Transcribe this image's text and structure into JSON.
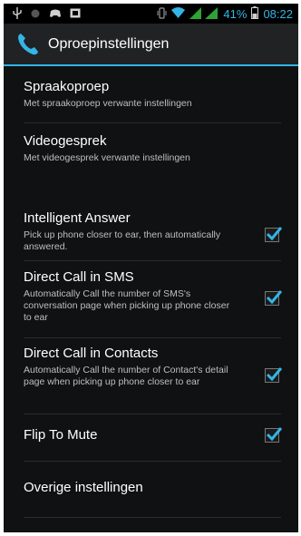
{
  "status_bar": {
    "battery_percent": "41%",
    "time": "08:22",
    "icons": [
      "usb-icon",
      "notification-icon",
      "gamepad-icon",
      "image-icon",
      "vibrate-icon",
      "wifi-icon",
      "signal-icon",
      "battery-icon"
    ]
  },
  "action_bar": {
    "title": "Oproepinstellingen",
    "icon": "phone-icon"
  },
  "settings": [
    {
      "title": "Spraakoproep",
      "subtitle": "Met spraakoproep verwante instellingen"
    },
    {
      "title": "Videogesprek",
      "subtitle": "Met videogesprek verwante instellingen"
    },
    {
      "title": "Intelligent Answer",
      "subtitle": "Pick up phone closer to ear, then automatically answered.",
      "checked": true
    },
    {
      "title": "Direct Call in SMS",
      "subtitle": "Automatically Call the number of SMS's conversation page when picking up phone closer to ear",
      "checked": true
    },
    {
      "title": "Direct Call in Contacts",
      "subtitle": "Automatically Call the number of Contact's detail page when picking up phone closer to ear",
      "checked": true
    },
    {
      "title": "Flip To Mute",
      "checked": true
    },
    {
      "title": "Overige instellingen"
    }
  ],
  "colors": {
    "accent": "#33b5e5",
    "background": "#101112",
    "action_bar": "#202224",
    "divider": "#2a2c2e"
  }
}
